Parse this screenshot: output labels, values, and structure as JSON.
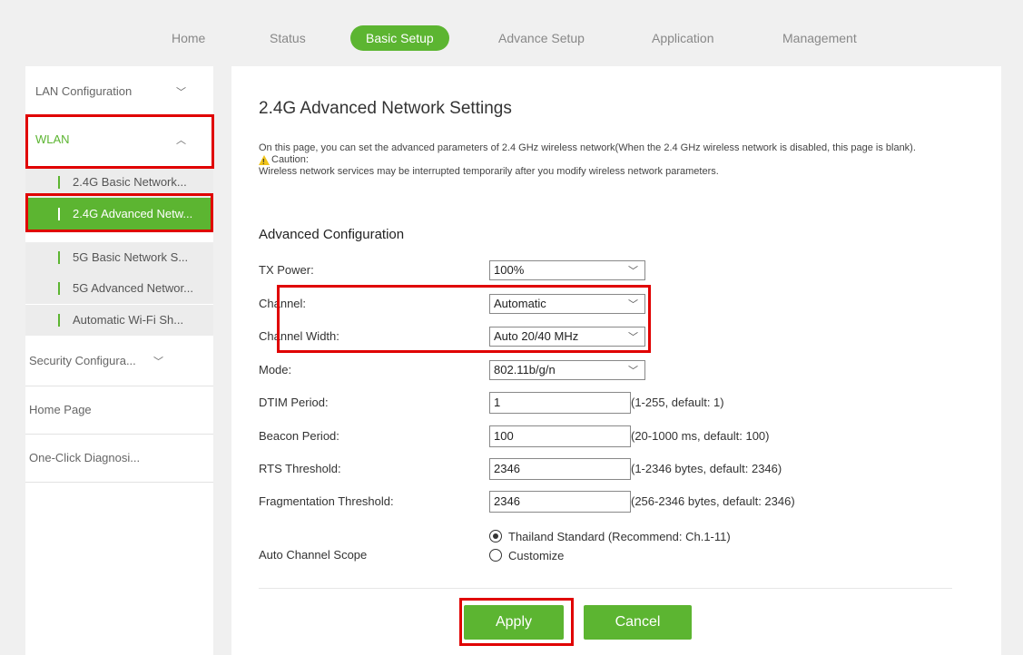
{
  "nav": {
    "home": "Home",
    "status": "Status",
    "basic_setup": "Basic Setup",
    "advance_setup": "Advance Setup",
    "application": "Application",
    "management": "Management"
  },
  "sidebar": {
    "lan": "LAN Configuration",
    "wlan": "WLAN",
    "sub_items": [
      "2.4G Basic Network...",
      "2.4G Advanced Netw...",
      "5G Basic Network S...",
      "5G Advanced Networ...",
      "Automatic Wi-Fi Sh..."
    ],
    "security": "Security Configura...",
    "home_page": "Home Page",
    "diagnosis": "One-Click Diagnosi..."
  },
  "page": {
    "title": "2.4G Advanced Network Settings",
    "description": "On this page, you can set the advanced parameters of 2.4 GHz wireless network(When the 2.4 GHz wireless network is disabled, this page is blank).",
    "caution_label": "Caution:",
    "caution_text": "Wireless network services may be interrupted temporarily after you modify wireless network parameters.",
    "section_title": "Advanced Configuration"
  },
  "form": {
    "tx_power": {
      "label": "TX Power:",
      "value": "100%"
    },
    "channel": {
      "label": "Channel:",
      "value": "Automatic"
    },
    "channel_width": {
      "label": "Channel Width:",
      "value": "Auto 20/40 MHz"
    },
    "mode": {
      "label": "Mode:",
      "value": "802.11b/g/n"
    },
    "dtim": {
      "label": "DTIM Period:",
      "value": "1",
      "hint": "(1-255, default: 1)"
    },
    "beacon": {
      "label": "Beacon Period:",
      "value": "100",
      "hint": "(20-1000 ms, default: 100)"
    },
    "rts": {
      "label": "RTS Threshold:",
      "value": "2346",
      "hint": "(1-2346 bytes, default: 2346)"
    },
    "frag": {
      "label": "Fragmentation Threshold:",
      "value": "2346",
      "hint": "(256-2346 bytes, default: 2346)"
    },
    "auto_channel": {
      "label": "Auto Channel Scope",
      "options": [
        "Thailand Standard (Recommend: Ch.1-11)",
        "Customize"
      ],
      "selected": "Thailand Standard (Recommend: Ch.1-11)"
    }
  },
  "buttons": {
    "apply": "Apply",
    "cancel": "Cancel"
  },
  "colors": {
    "accent": "#5cb531",
    "highlight": "#e00000"
  }
}
